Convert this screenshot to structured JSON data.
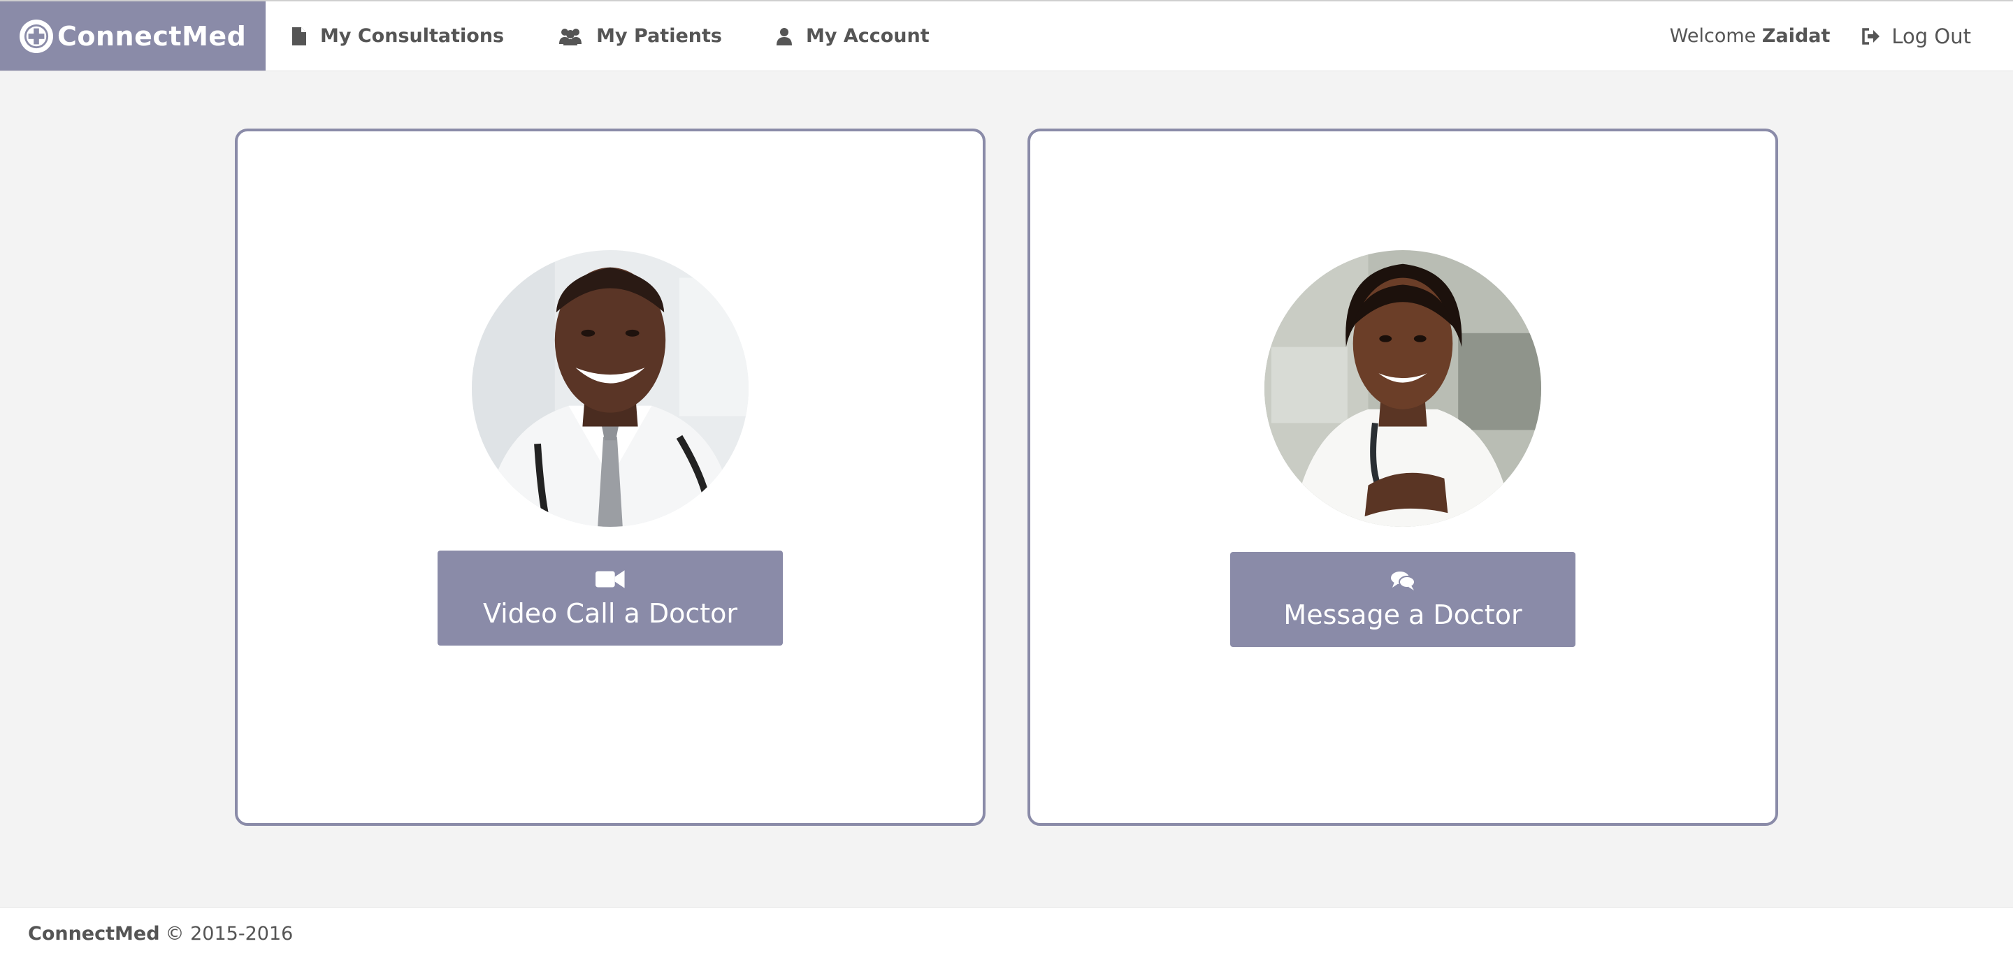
{
  "navbar": {
    "brand": "ConnectMed",
    "links": [
      {
        "label": "My Consultations",
        "icon": "file-icon"
      },
      {
        "label": "My Patients",
        "icon": "users-icon"
      },
      {
        "label": "My Account",
        "icon": "user-icon"
      }
    ],
    "welcome_prefix": "Welcome",
    "username": "Zaidat",
    "logout_label": "Log Out",
    "logout_icon": "sign-out-icon"
  },
  "cards": [
    {
      "button_label": "Video Call a Doctor",
      "button_icon": "video-camera-icon",
      "avatar": "male-doctor-photo"
    },
    {
      "button_label": "Message a Doctor",
      "button_icon": "comments-icon",
      "avatar": "female-doctor-photo"
    }
  ],
  "footer": {
    "brand": "ConnectMed",
    "copyright": "© 2015-2016"
  },
  "colors": {
    "accent": "#8a8ba8",
    "background": "#f3f3f3",
    "text": "#555555"
  }
}
